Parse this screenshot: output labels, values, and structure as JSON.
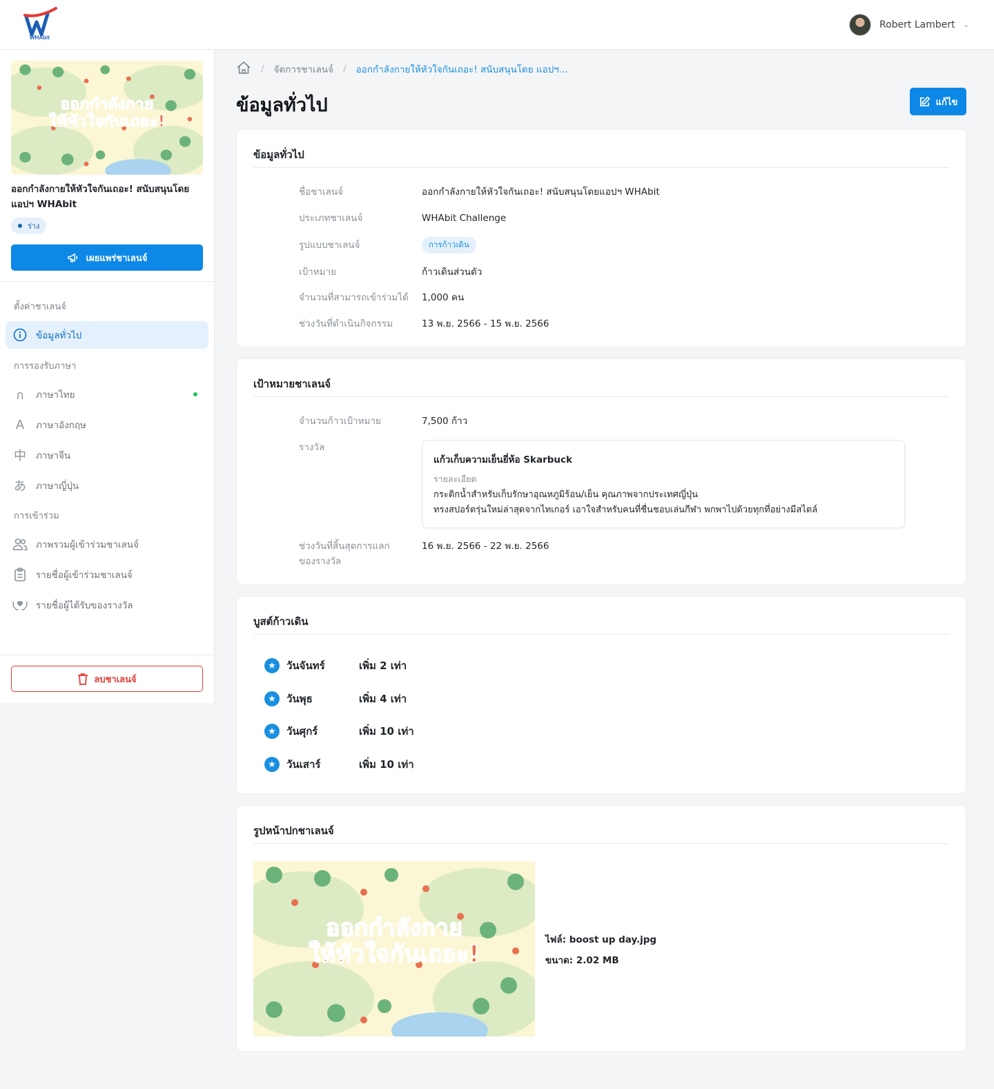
{
  "app": {
    "logo_text": "WHAbit",
    "user_name": "Robert Lambert"
  },
  "colors": {
    "primary": "#0d88e6",
    "link": "#1a8fe0",
    "danger": "#e53935",
    "success": "#22c55e"
  },
  "sidebar": {
    "challenge_title": "ออกกำลังกายให้หัวใจกันเถอะ! สนับสนุนโดยแอปฯ WHAbit",
    "cover_text_line1": "ออกกำลังกาย",
    "cover_text_line2": "ให้หัวใจกันเถอะ!",
    "status_badge": "ร่าง",
    "publish_label": "เผยแพร่ชาเลนจ์",
    "section_settings": "ตั้งค่าชาเลนจ์",
    "section_language": "การรองรับภาษา",
    "section_participation": "การเข้าร่วม",
    "items": [
      {
        "label": "ข้อมูลทั่วไป",
        "icon": "info-circle-icon"
      },
      {
        "label": "ภาษาไทย",
        "icon": "thai-letter-icon",
        "glyph": "ก"
      },
      {
        "label": "ภาษาอังกฤษ",
        "icon": "latin-letter-icon",
        "glyph": "A"
      },
      {
        "label": "ภาษาจีน",
        "icon": "chinese-char-icon",
        "glyph": "中"
      },
      {
        "label": "ภาษาญี่ปุ่น",
        "icon": "japanese-char-icon",
        "glyph": "あ"
      },
      {
        "label": "ภาพรวมผู้เข้าร่วมชาเลนจ์",
        "icon": "users-icon"
      },
      {
        "label": "รายชื่อผู้เข้าร่วมชาเลนจ์",
        "icon": "clipboard-list-icon"
      },
      {
        "label": "รายชื่อผู้ได้รับของรางวัล",
        "icon": "reward-hands-icon"
      }
    ],
    "delete_label": "ลบชาเลนจ์"
  },
  "breadcrumb": {
    "home_icon": "home-icon",
    "level1": "จัดการชาเลนจ์",
    "level2": "ออกกำลังกายให้หัวใจกันเถอะ! สนับสนุนโดย แอปฯ..."
  },
  "page": {
    "title": "ข้อมูลทั่วไป",
    "edit_label": "แก้ไข"
  },
  "general": {
    "heading": "ข้อมูลทั่วไป",
    "rows": [
      {
        "label": "ชื่อชาเลนจ์",
        "value": "ออกกำลังกายให้หัวใจกันเถอะ! สนับสนุนโดยแอปฯ WHAbit"
      },
      {
        "label": "ประเภทชาเลนจ์",
        "value": "WHAbit Challenge"
      },
      {
        "label": "รูปแบบชาเลนจ์",
        "value": "การก้าวเดิน"
      },
      {
        "label": "เป้าหมาย",
        "value": "ก้าวเดินส่วนตัว"
      },
      {
        "label": "จำนวนที่สามารถเข้าร่วมได้",
        "value": "1,000 คน"
      },
      {
        "label": "ช่วงวันที่ดำเนินกิจกรรม",
        "value": "13 พ.ย. 2566 - 15 พ.ย. 2566"
      }
    ]
  },
  "goal": {
    "heading": "เป้าหมายชาเลนจ์",
    "steps_label": "จำนวนก้าวเป้าหมาย",
    "steps_value": "7,500 ก้าว",
    "reward_label": "รางวัล",
    "reward_title": "แก้วเก็บความเย็นยี่ห้อ Skarbuck",
    "reward_detail_label": "รายละเอียด",
    "reward_desc_line1": "กระติกน้ำสำหรับเก็บรักษาอุณหภูมิร้อน/เย็น คุณภาพจากประเทศญี่ปุ่น",
    "reward_desc_line2": "ทรงสปอร์ตรุ่นใหม่ล่าสุดจากไทเกอร์ เอาใจสำหรับคนที่ชื่นชอบเล่นกีฬา  พกพาไปด้วยทุกที่อย่างมีสไตล์",
    "redeem_label_line1": "ช่วงวันที่สิ้นสุดการแลก",
    "redeem_label_line2": "ของรางวัล",
    "redeem_value": "16 พ.ย. 2566 - 22 พ.ย. 2566"
  },
  "boost": {
    "heading": "บูสต์ก้าวเดิน",
    "rows": [
      {
        "day": "วันจันทร์",
        "multiplier": "เพิ่ม 2 เท่า"
      },
      {
        "day": "วันพุธ",
        "multiplier": "เพิ่ม 4 เท่า"
      },
      {
        "day": "วันศุกร์",
        "multiplier": "เพิ่ม 10 เท่า"
      },
      {
        "day": "วันเสาร์",
        "multiplier": "เพิ่ม 10 เท่า"
      }
    ]
  },
  "cover": {
    "heading": "รูปหน้าปกชาเลนจ์",
    "file_label": "ไฟล์: boost up day.jpg",
    "size_label": "ขนาด: 2.02 MB"
  }
}
